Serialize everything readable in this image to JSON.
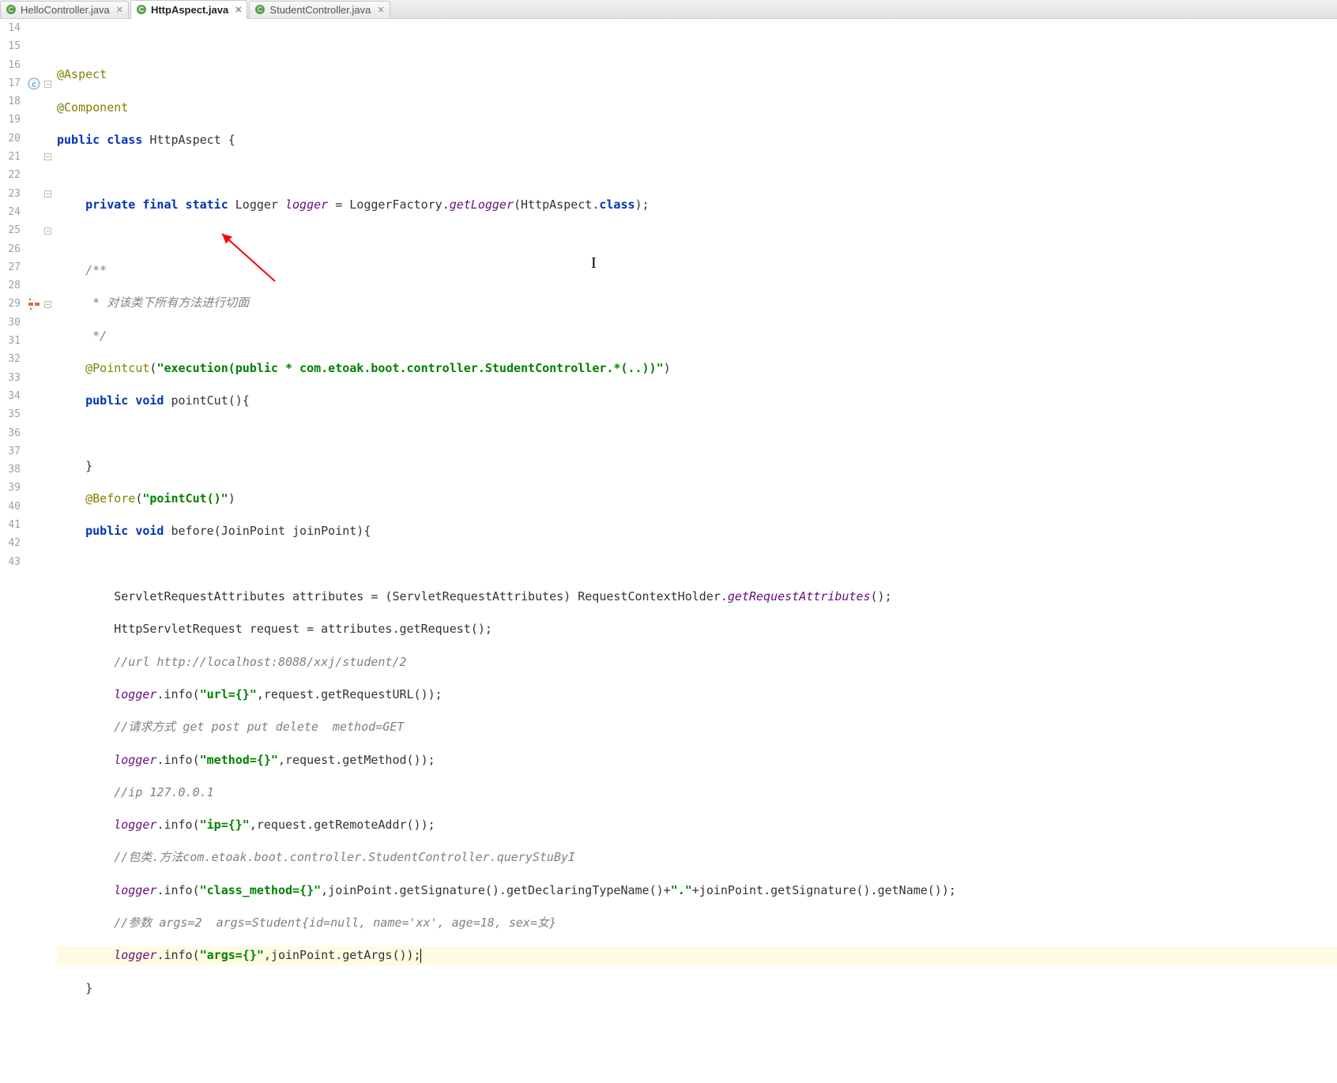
{
  "tabs": [
    {
      "label": "HelloController.java",
      "active": false
    },
    {
      "label": "HttpAspect.java",
      "active": true
    },
    {
      "label": "StudentController.java",
      "active": false
    }
  ],
  "lines": {
    "start": 14,
    "end": 43
  },
  "code": {
    "l15_ann": "@Aspect",
    "l16_ann": "@Component",
    "l17_kw1": "public class ",
    "l17_name": "HttpAspect {",
    "l19_1": "private final static ",
    "l19_2": "Logger ",
    "l19_logger": "logger",
    "l19_3": " = LoggerFactory.",
    "l19_getLogger": "getLogger",
    "l19_4": "(HttpAspect.",
    "l19_class": "class",
    "l19_5": ");",
    "l21_cmt": "/**",
    "l22_cmt": " * 对该类下所有方法进行切面",
    "l23_cmt": " */",
    "l24_ann": "@Pointcut",
    "l24_open": "(",
    "l24_str": "\"execution(public * com.etoak.boot.controller.StudentController.*(..))\"",
    "l24_close": ")",
    "l25_1": "public void ",
    "l25_2": "pointCut(){",
    "l27_1": "}",
    "l28_ann": "@Before",
    "l28_open": "(",
    "l28_str": "\"pointCut()\"",
    "l28_close": ")",
    "l29_1": "public void ",
    "l29_2": "before(JoinPoint joinPoint){",
    "l31_1": "ServletRequestAttributes attributes = (ServletRequestAttributes) RequestContextHolder.",
    "l31_gra": "getRequestAttributes",
    "l31_2": "();",
    "l32_1": "HttpServletRequest request = attributes.getRequest();",
    "l33_cmt": "//url http://localhost:8088/xxj/student/2",
    "l34_logger": "logger",
    "l34_1": ".info(",
    "l34_str": "\"url={}\"",
    "l34_2": ",request.getRequestURL());",
    "l35_cmt": "//请求方式 get post put delete  method=GET",
    "l36_logger": "logger",
    "l36_1": ".info(",
    "l36_str": "\"method={}\"",
    "l36_2": ",request.getMethod());",
    "l37_cmt": "//ip 127.0.0.1",
    "l38_logger": "logger",
    "l38_1": ".info(",
    "l38_str": "\"ip={}\"",
    "l38_2": ",request.getRemoteAddr());",
    "l39_cmt": "//包类.方法com.etoak.boot.controller.StudentController.queryStuByI",
    "l40_logger": "logger",
    "l40_1": ".info(",
    "l40_str": "\"class_method={}\"",
    "l40_2": ",joinPoint.getSignature().getDeclaringTypeName()+",
    "l40_dot": "\".\"",
    "l40_3": "+joinPoint.getSignature().getName());",
    "l41_cmt": "//参数 args=2  args=Student{id=null, name='xx', age=18, sex=女}",
    "l42_logger": "logger",
    "l42_1": ".info(",
    "l42_str": "\"args={}\"",
    "l42_2": ",joinPoint.getArgs());",
    "l43_1": "}"
  }
}
